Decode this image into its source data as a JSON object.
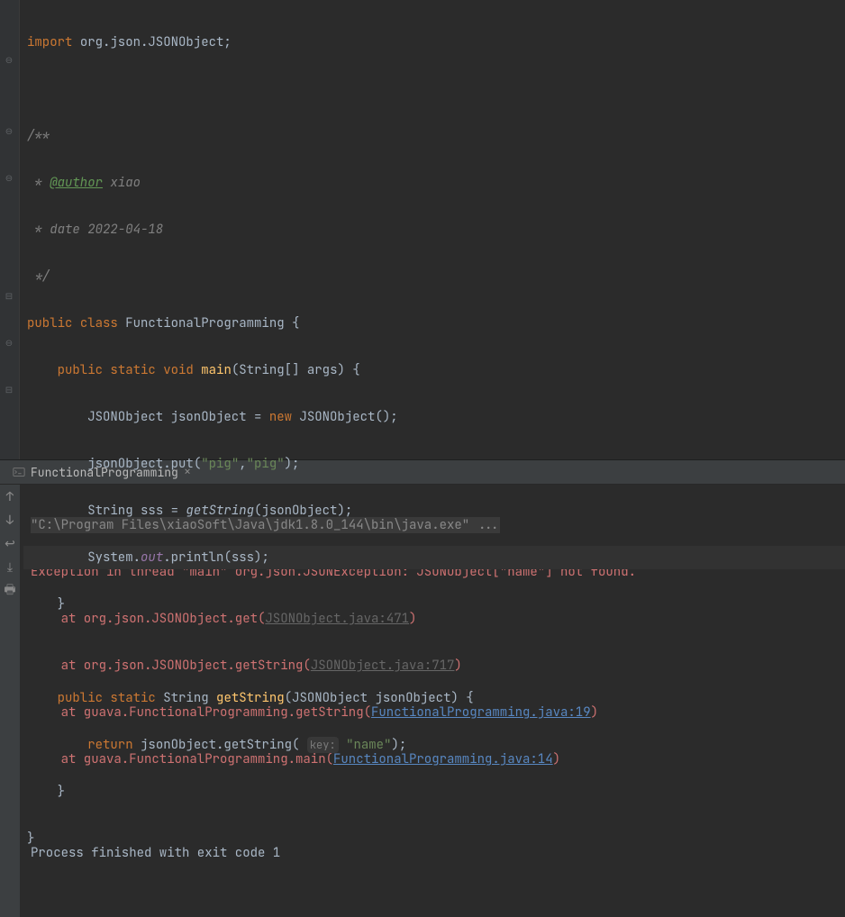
{
  "editor": {
    "line1": {
      "kw_import": "import",
      "pkg": "org.json.JSONObject",
      "semi": ";"
    },
    "doc": {
      "open": "/**",
      "star": " * ",
      "author_tag": "@author",
      "author_val": " xiao",
      "date_line": " * date 2022-04-18",
      "close": " */"
    },
    "cls": {
      "public": "public",
      "class_kw": "class",
      "name": "FunctionalProgramming",
      "brace": "{"
    },
    "main": {
      "public": "public",
      "static": "static",
      "void": "void",
      "name": "main",
      "lp": "(",
      "argtype": "String[] args",
      "rp": ")",
      "brace": "{"
    },
    "l1": {
      "type": "JSONObject",
      "var": "jsonObject",
      "eq": " = ",
      "new": "new",
      "ctor": "JSONObject",
      "parens": "()",
      "semi": ";"
    },
    "l2": {
      "obj": "jsonObject",
      "dot": ".",
      "m": "put",
      "lp": "(",
      "s1": "\"pig\"",
      "comma": ",",
      "s2": "\"pig\"",
      "rp": ")",
      "semi": ";"
    },
    "l3": {
      "type": "String",
      "var": "sss",
      "eq": " = ",
      "call": "getString",
      "lp": "(",
      "arg": "jsonObject",
      "rp": ")",
      "semi": ";"
    },
    "l4": {
      "sys": "System",
      "dot1": ".",
      "out": "out",
      "dot2": ".",
      "m": "println",
      "lp": "(",
      "arg": "sss",
      "rp": ")",
      "semi": ";"
    },
    "close_main": "}",
    "gs": {
      "public": "public",
      "static": "static",
      "ret": "String",
      "name": "getString",
      "lp": "(",
      "ptype": "JSONObject",
      "pname": "jsonObject",
      "rp": ")",
      "brace": "{"
    },
    "gsbody": {
      "ret": "return",
      "obj": "jsonObject",
      "dot": ".",
      "m": "getString",
      "lp": "(",
      "hint": "key:",
      "str": "\"name\"",
      "rp": ")",
      "semi": ";"
    },
    "close_gs": "}",
    "close_cls": "}"
  },
  "tab": {
    "name": "FunctionalProgramming",
    "close": "×"
  },
  "console": {
    "cmd": "\"C:\\Program Files\\xiaoSoft\\Java\\jdk1.8.0_144\\bin\\java.exe\" ...",
    "exc": "Exception in thread \"main\" org.json.JSONException: JSONObject[\"name\"] not found.",
    "at1": "    at org.json.JSONObject.get(",
    "link1": "JSONObject.java:471",
    "rp1": ")",
    "at2": "    at org.json.JSONObject.getString(",
    "link2": "JSONObject.java:717",
    "rp2": ")",
    "at3": "    at guava.FunctionalProgramming.getString(",
    "link3": "FunctionalProgramming.java:19",
    "rp3": ")",
    "at4": "    at guava.FunctionalProgramming.main(",
    "link4": "FunctionalProgramming.java:14",
    "rp4": ")",
    "exit": "Process finished with exit code 1"
  }
}
